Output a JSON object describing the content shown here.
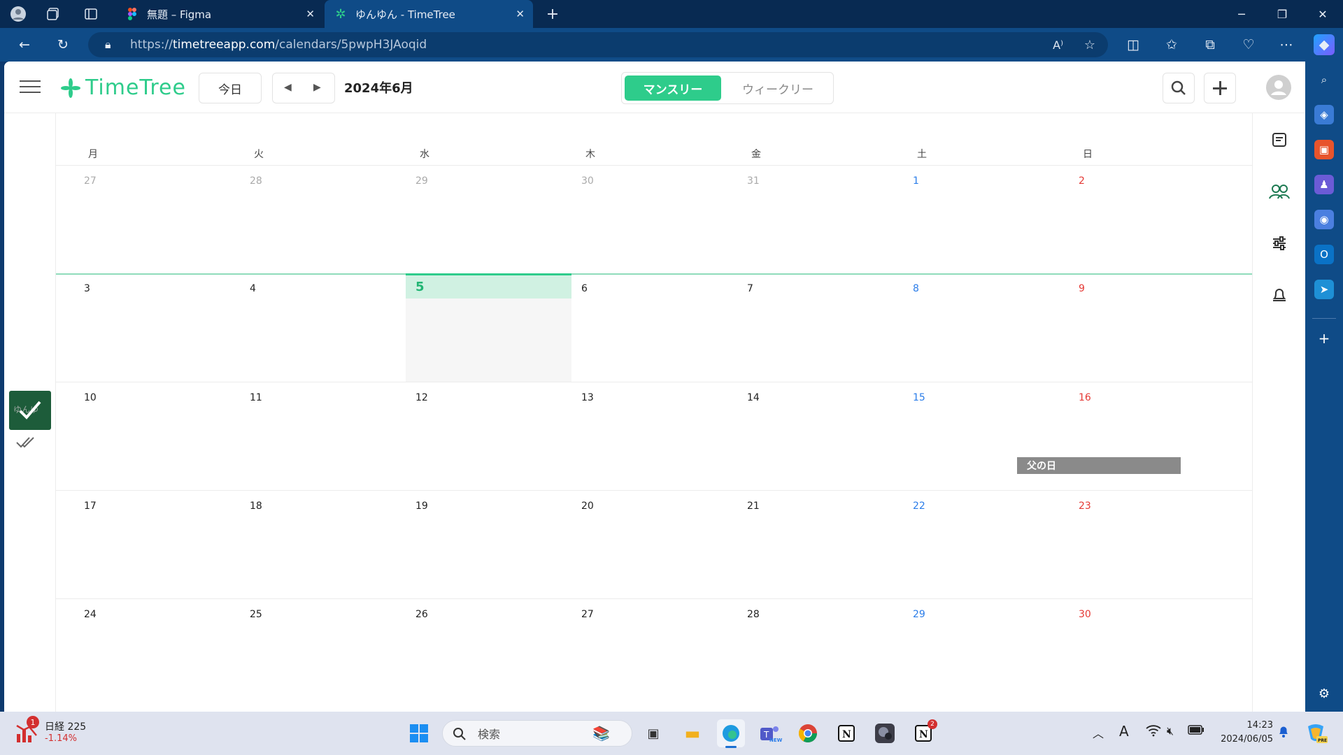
{
  "browser": {
    "tabs": [
      {
        "title": "無題 – Figma",
        "active": false
      },
      {
        "title": "ゆんゆん - TimeTree",
        "active": true
      }
    ],
    "url_prefix": "https://",
    "url_host": "timetreeapp.com",
    "url_path": "/calendars/5pwpH3JAoqid"
  },
  "header": {
    "logo": "TimeTree",
    "today_label": "今日",
    "month_title": "2024年6月",
    "view_monthly": "マンスリー",
    "view_weekly": "ウィークリー"
  },
  "calendar": {
    "weekdays": [
      "月",
      "火",
      "水",
      "木",
      "金",
      "土",
      "日"
    ],
    "weeks": [
      [
        "27",
        "28",
        "29",
        "30",
        "31",
        "1",
        "2"
      ],
      [
        "3",
        "4",
        "5",
        "6",
        "7",
        "8",
        "9"
      ],
      [
        "10",
        "11",
        "12",
        "13",
        "14",
        "15",
        "16"
      ],
      [
        "17",
        "18",
        "19",
        "20",
        "21",
        "22",
        "23"
      ],
      [
        "24",
        "25",
        "26",
        "27",
        "28",
        "29",
        "30"
      ]
    ],
    "today": "5",
    "event": {
      "label": "父の日",
      "date": "16"
    }
  },
  "left_rail": {
    "avatar_text": "ゆんゆ"
  },
  "taskbar": {
    "stock_name": "日経 225",
    "stock_change": "-1.14%",
    "stock_badge": "1",
    "search_placeholder": "検索",
    "teams_badge_text": "NEW",
    "notion_badge": "2",
    "time": "14:23",
    "date": "2024/06/05"
  },
  "colors": {
    "accent": "#2ecc8b",
    "saturday": "#2b7de9",
    "sunday": "#e53935",
    "event": "#8a8a8a",
    "browser_bar": "#0f4b87"
  }
}
